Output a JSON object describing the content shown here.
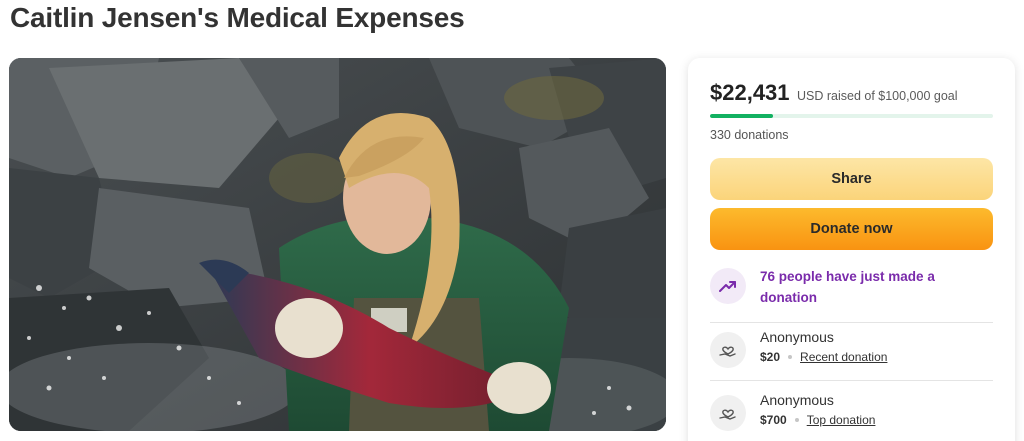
{
  "page": {
    "title": "Caitlin Jensen's Medical Expenses"
  },
  "hero": {
    "icon": "fundraiser-cover-photo"
  },
  "donation_card": {
    "raised_amount": "$22,431",
    "raised_text": "USD raised of $100,000 goal",
    "progress_fraction": 0.2243,
    "donation_count": "330 donations",
    "share_label": "Share",
    "donate_label": "Donate now",
    "activity": {
      "icon": "trending-up-icon",
      "text": "76 people have just made a donation"
    },
    "donors": [
      {
        "name": "Anonymous",
        "amount": "$20",
        "tag": "Recent donation",
        "icon": "heart-hand-icon"
      },
      {
        "name": "Anonymous",
        "amount": "$700",
        "tag": "Top donation",
        "icon": "heart-hand-icon"
      }
    ]
  },
  "colors": {
    "progress": "#12b161",
    "activity_text": "#7a2bab",
    "donate_button": "#f99311",
    "share_button": "#fbd47a"
  }
}
